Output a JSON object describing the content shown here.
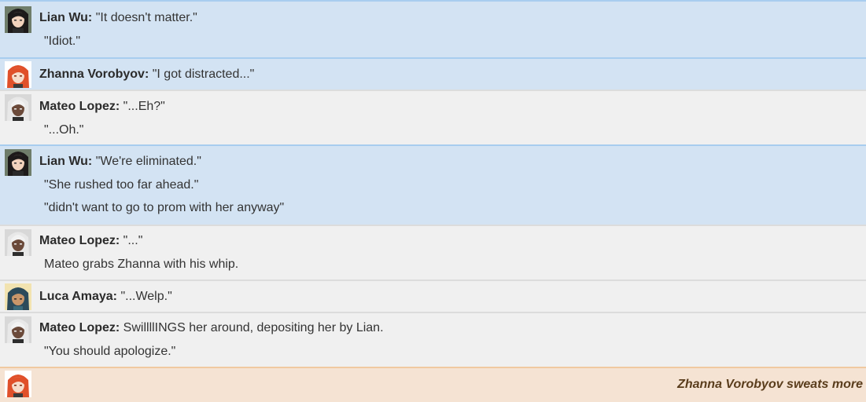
{
  "messages": [
    {
      "speaker": "Lian Wu:",
      "avatar_icon": "lian-wu-avatar",
      "lines": [
        "\"It doesn't matter.\"",
        "\"Idiot.\""
      ]
    },
    {
      "speaker": "Zhanna Vorobyov:",
      "avatar_icon": "zhanna-vorobyov-avatar",
      "lines": [
        "\"I got distracted...\""
      ]
    },
    {
      "speaker": "Mateo Lopez:",
      "avatar_icon": "mateo-lopez-avatar",
      "lines": [
        "\"...Eh?\"",
        "\"...Oh.\""
      ]
    },
    {
      "speaker": "Lian Wu:",
      "avatar_icon": "lian-wu-avatar",
      "lines": [
        "\"We're eliminated.\"",
        "\"She rushed too far ahead.\"",
        "\"didn't want to go to prom with her anyway\""
      ]
    },
    {
      "speaker": "Mateo Lopez:",
      "avatar_icon": "mateo-lopez-avatar",
      "lines": [
        "\"...\"",
        "Mateo grabs Zhanna with his whip."
      ]
    },
    {
      "speaker": "Luca Amaya:",
      "avatar_icon": "luca-amaya-avatar",
      "lines": [
        "\"...Welp.\""
      ]
    },
    {
      "speaker": "Mateo Lopez:",
      "avatar_icon": "mateo-lopez-avatar",
      "lines": [
        "SwillllINGS her around, depositing her by Lian.",
        "\"You should apologize.\""
      ]
    },
    {
      "speaker": "",
      "avatar_icon": "zhanna-vorobyov-avatar",
      "action": "Zhanna Vorobyov sweats more"
    }
  ],
  "colors": {
    "blue_row": "#d3e3f3",
    "gray_row": "#f0f0f0",
    "action_row": "#f5e3d3",
    "action_text": "#5a3d1c"
  }
}
